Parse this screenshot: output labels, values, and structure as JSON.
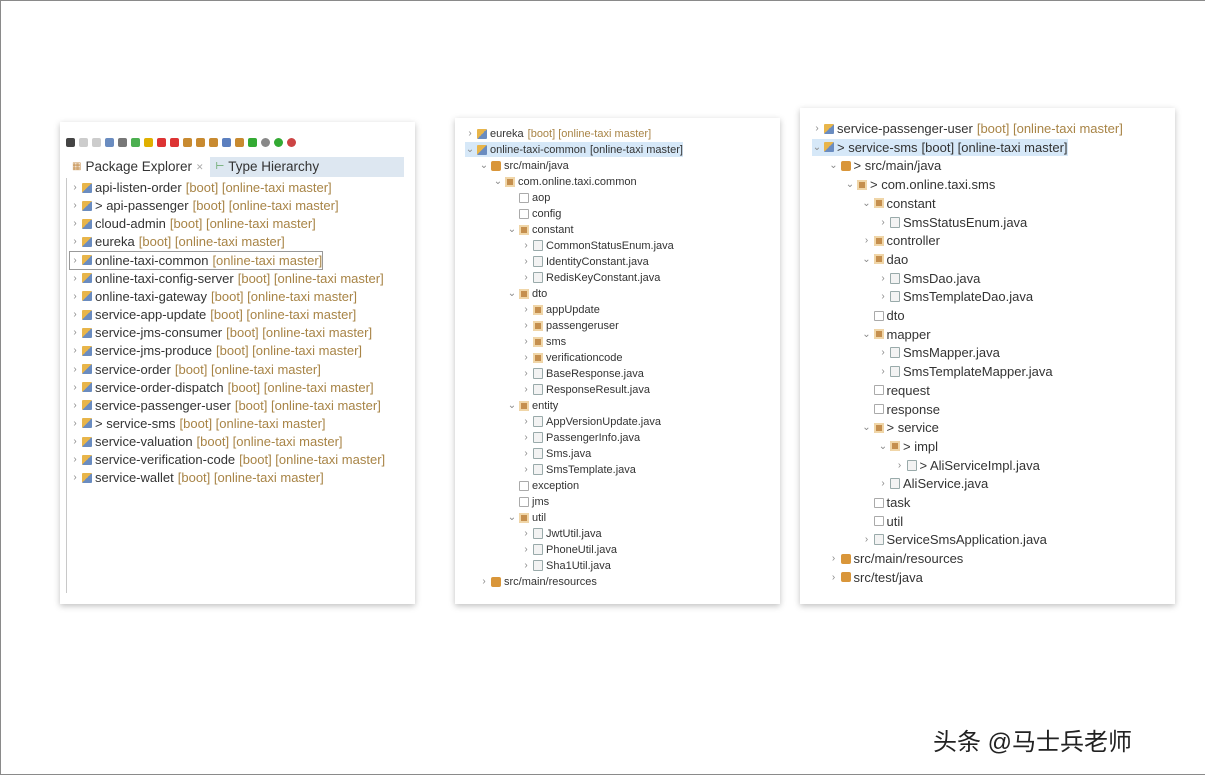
{
  "left_panel": {
    "tabs": [
      {
        "label": "Package Explorer",
        "active": true
      },
      {
        "label": "Type Hierarchy",
        "active": false
      }
    ],
    "toolbar_icons": [
      "view-menu-icon",
      "save-icon",
      "save-all-icon",
      "monitor-icon",
      "pen-icon",
      "run-icon",
      "resume-icon",
      "stop-icon",
      "disconnect-icon",
      "step-into-icon",
      "step-over-icon",
      "step-return-icon",
      "console-icon",
      "build-icon",
      "spring-boot-icon",
      "gear-icon",
      "run-dropdown-icon",
      "debug-dropdown-icon"
    ],
    "rows": [
      {
        "d": 0,
        "a": ">",
        "i": "proj",
        "label": "api-listen-order",
        "suffix": "[boot] [online-taxi master]"
      },
      {
        "d": 0,
        "a": ">",
        "i": "proj",
        "label": "> api-passenger",
        "suffix": "[boot] [online-taxi master]"
      },
      {
        "d": 0,
        "a": ">",
        "i": "proj",
        "label": "cloud-admin",
        "suffix": "[boot] [online-taxi master]"
      },
      {
        "d": 0,
        "a": ">",
        "i": "proj",
        "label": "eureka",
        "suffix": "[boot] [online-taxi master]"
      },
      {
        "d": 0,
        "a": ">",
        "i": "proj",
        "label": "online-taxi-common",
        "suffix": "[online-taxi master]",
        "boxed": true
      },
      {
        "d": 0,
        "a": ">",
        "i": "proj",
        "label": "online-taxi-config-server",
        "suffix": "[boot] [online-taxi master]"
      },
      {
        "d": 0,
        "a": ">",
        "i": "proj",
        "label": "online-taxi-gateway",
        "suffix": "[boot] [online-taxi master]"
      },
      {
        "d": 0,
        "a": ">",
        "i": "proj",
        "label": "service-app-update",
        "suffix": "[boot] [online-taxi master]"
      },
      {
        "d": 0,
        "a": ">",
        "i": "proj",
        "label": "service-jms-consumer",
        "suffix": "[boot] [online-taxi master]"
      },
      {
        "d": 0,
        "a": ">",
        "i": "proj",
        "label": "service-jms-produce",
        "suffix": "[boot] [online-taxi master]"
      },
      {
        "d": 0,
        "a": ">",
        "i": "proj",
        "label": "service-order",
        "suffix": "[boot] [online-taxi master]"
      },
      {
        "d": 0,
        "a": ">",
        "i": "proj",
        "label": "service-order-dispatch",
        "suffix": "[boot] [online-taxi master]"
      },
      {
        "d": 0,
        "a": ">",
        "i": "proj",
        "label": "service-passenger-user",
        "suffix": "[boot] [online-taxi master]"
      },
      {
        "d": 0,
        "a": ">",
        "i": "proj",
        "label": "> service-sms",
        "suffix": "[boot] [online-taxi master]"
      },
      {
        "d": 0,
        "a": ">",
        "i": "proj",
        "label": "service-valuation",
        "suffix": "[boot] [online-taxi master]"
      },
      {
        "d": 0,
        "a": ">",
        "i": "proj",
        "label": "service-verification-code",
        "suffix": "[boot] [online-taxi master]"
      },
      {
        "d": 0,
        "a": ">",
        "i": "proj",
        "label": "service-wallet",
        "suffix": "[boot] [online-taxi master]"
      }
    ]
  },
  "middle_panel": {
    "rows": [
      {
        "d": 0,
        "a": ">",
        "i": "proj",
        "label": "eureka",
        "suffix": "[boot] [online-taxi master]"
      },
      {
        "d": 0,
        "a": "v",
        "i": "proj",
        "label": "online-taxi-common",
        "suffix": "[online-taxi master]",
        "sel": true
      },
      {
        "d": 1,
        "a": "v",
        "i": "src",
        "label": "src/main/java"
      },
      {
        "d": 2,
        "a": "v",
        "i": "pkg",
        "label": "com.online.taxi.common"
      },
      {
        "d": 3,
        "a": "",
        "i": "empty",
        "label": "aop"
      },
      {
        "d": 3,
        "a": "",
        "i": "empty",
        "label": "config"
      },
      {
        "d": 3,
        "a": "v",
        "i": "pkg",
        "label": "constant"
      },
      {
        "d": 4,
        "a": ">",
        "i": "java",
        "label": "CommonStatusEnum.java"
      },
      {
        "d": 4,
        "a": ">",
        "i": "java",
        "label": "IdentityConstant.java"
      },
      {
        "d": 4,
        "a": ">",
        "i": "java",
        "label": "RedisKeyConstant.java"
      },
      {
        "d": 3,
        "a": "v",
        "i": "pkg",
        "label": "dto"
      },
      {
        "d": 4,
        "a": ">",
        "i": "pkg",
        "label": "appUpdate"
      },
      {
        "d": 4,
        "a": ">",
        "i": "pkg",
        "label": "passengeruser"
      },
      {
        "d": 4,
        "a": ">",
        "i": "pkg",
        "label": "sms"
      },
      {
        "d": 4,
        "a": ">",
        "i": "pkg",
        "label": "verificationcode"
      },
      {
        "d": 4,
        "a": ">",
        "i": "java",
        "label": "BaseResponse.java"
      },
      {
        "d": 4,
        "a": ">",
        "i": "java",
        "label": "ResponseResult.java"
      },
      {
        "d": 3,
        "a": "v",
        "i": "pkg",
        "label": "entity"
      },
      {
        "d": 4,
        "a": ">",
        "i": "java",
        "label": "AppVersionUpdate.java"
      },
      {
        "d": 4,
        "a": ">",
        "i": "java",
        "label": "PassengerInfo.java"
      },
      {
        "d": 4,
        "a": ">",
        "i": "java",
        "label": "Sms.java"
      },
      {
        "d": 4,
        "a": ">",
        "i": "java",
        "label": "SmsTemplate.java"
      },
      {
        "d": 3,
        "a": "",
        "i": "empty",
        "label": "exception"
      },
      {
        "d": 3,
        "a": "",
        "i": "empty",
        "label": "jms"
      },
      {
        "d": 3,
        "a": "v",
        "i": "pkg",
        "label": "util"
      },
      {
        "d": 4,
        "a": ">",
        "i": "java",
        "label": "JwtUtil.java"
      },
      {
        "d": 4,
        "a": ">",
        "i": "java",
        "label": "PhoneUtil.java"
      },
      {
        "d": 4,
        "a": ">",
        "i": "java",
        "label": "Sha1Util.java"
      },
      {
        "d": 1,
        "a": ">",
        "i": "src",
        "label": "src/main/resources"
      }
    ]
  },
  "right_panel": {
    "rows": [
      {
        "d": 0,
        "a": ">",
        "i": "proj",
        "label": "service-passenger-user",
        "suffix": "[boot] [online-taxi master]"
      },
      {
        "d": 0,
        "a": "v",
        "i": "proj",
        "label": "> service-sms",
        "suffix": "[boot] [online-taxi master]",
        "sel": true
      },
      {
        "d": 1,
        "a": "v",
        "i": "src",
        "label": "> src/main/java"
      },
      {
        "d": 2,
        "a": "v",
        "i": "pkg",
        "label": "> com.online.taxi.sms"
      },
      {
        "d": 3,
        "a": "v",
        "i": "pkg",
        "label": "constant"
      },
      {
        "d": 4,
        "a": ">",
        "i": "java",
        "label": "SmsStatusEnum.java"
      },
      {
        "d": 3,
        "a": ">",
        "i": "pkg",
        "label": "controller"
      },
      {
        "d": 3,
        "a": "v",
        "i": "pkg",
        "label": "dao"
      },
      {
        "d": 4,
        "a": ">",
        "i": "java",
        "label": "SmsDao.java"
      },
      {
        "d": 4,
        "a": ">",
        "i": "java",
        "label": "SmsTemplateDao.java"
      },
      {
        "d": 3,
        "a": "",
        "i": "empty",
        "label": "dto"
      },
      {
        "d": 3,
        "a": "v",
        "i": "pkg",
        "label": "mapper"
      },
      {
        "d": 4,
        "a": ">",
        "i": "java",
        "label": "SmsMapper.java"
      },
      {
        "d": 4,
        "a": ">",
        "i": "java",
        "label": "SmsTemplateMapper.java"
      },
      {
        "d": 3,
        "a": "",
        "i": "empty",
        "label": "request"
      },
      {
        "d": 3,
        "a": "",
        "i": "empty",
        "label": "response"
      },
      {
        "d": 3,
        "a": "v",
        "i": "pkg",
        "label": "> service"
      },
      {
        "d": 4,
        "a": "v",
        "i": "pkg",
        "label": "> impl"
      },
      {
        "d": 5,
        "a": ">",
        "i": "java",
        "label": "> AliServiceImpl.java"
      },
      {
        "d": 4,
        "a": ">",
        "i": "java",
        "label": "AliService.java"
      },
      {
        "d": 3,
        "a": "",
        "i": "empty",
        "label": "task"
      },
      {
        "d": 3,
        "a": "",
        "i": "empty",
        "label": "util"
      },
      {
        "d": 3,
        "a": ">",
        "i": "java",
        "label": "ServiceSmsApplication.java"
      },
      {
        "d": 1,
        "a": ">",
        "i": "src",
        "label": "src/main/resources"
      },
      {
        "d": 1,
        "a": ">",
        "i": "src",
        "label": "src/test/java"
      }
    ]
  },
  "watermark": "头条 @马士兵老师"
}
